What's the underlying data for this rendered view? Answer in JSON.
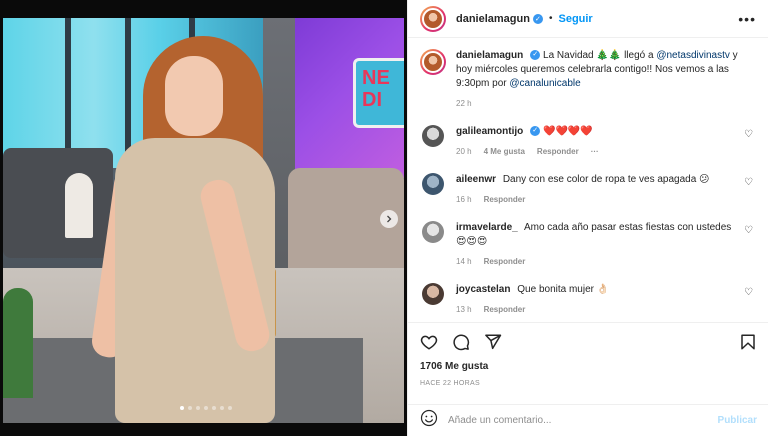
{
  "post": {
    "author": "danielamagun",
    "follow_label": "Seguir",
    "separator": "•",
    "caption_text_1": "La Navidad 🎄🎄 llegó a ",
    "caption_mention_1": "@netasdivinastv",
    "caption_text_2": " y hoy miércoles queremos celebrarla contigo!! Nos vemos a las 9:30pm por ",
    "caption_mention_2": "@canalunicable",
    "caption_time": "22 h",
    "image_sign_text": "NE DI"
  },
  "comments": [
    {
      "user": "galileamontijo",
      "text": "❤️❤️❤️❤️",
      "time": "20 h",
      "likes": "4 Me gusta",
      "reply": "Responder",
      "verified": true,
      "more": "···"
    },
    {
      "user": "aileenwr",
      "text": "Dany con ese color de ropa te ves apagada 😕",
      "time": "16 h",
      "reply": "Responder"
    },
    {
      "user": "irmavelarde_",
      "text": "Amo cada año pasar estas fiestas con ustedes 😍😍😍",
      "time": "14 h",
      "reply": "Responder"
    },
    {
      "user": "joycastelan",
      "text": "Que bonita mujer 👌🏻",
      "time": "13 h",
      "reply": "Responder"
    }
  ],
  "stats": {
    "likes": "1706 Me gusta",
    "posted": "HACE 22 HORAS"
  },
  "add_comment": {
    "placeholder": "Añade un comentario...",
    "publish_label": "Publicar"
  },
  "carousel": {
    "total": 7,
    "active": 1
  },
  "colors": {
    "link": "#0095f6",
    "mention": "#00376b",
    "verified": "#3897f0",
    "muted": "#8e8e8e"
  }
}
